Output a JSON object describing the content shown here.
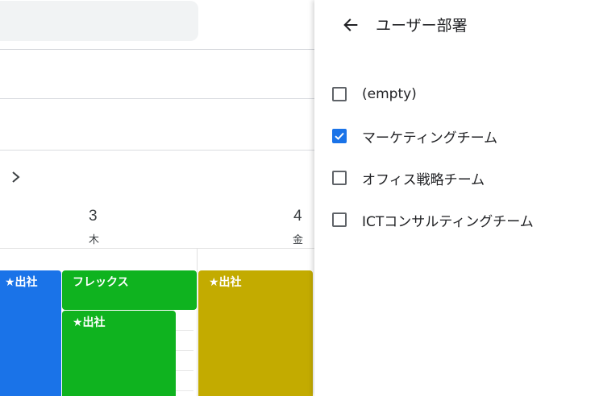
{
  "calendar": {
    "days": [
      {
        "number": "3",
        "weekday": "木"
      },
      {
        "number": "4",
        "weekday": "金"
      }
    ],
    "events": [
      {
        "label": "★出社",
        "color": "#1a73e8"
      },
      {
        "label": "フレックス",
        "color": "#0fb31f"
      },
      {
        "label": "★出社",
        "color": "#0fb31f"
      },
      {
        "label": "★出社",
        "color": "#c3ab00"
      }
    ]
  },
  "panel": {
    "title": "ユーザー部署",
    "back_icon": "arrow-left-icon",
    "options": [
      {
        "label": "(empty)",
        "checked": false
      },
      {
        "label": "マーケティングチーム",
        "checked": true
      },
      {
        "label": "オフィス戦略チーム",
        "checked": false
      },
      {
        "label": "ICTコンサルティングチーム",
        "checked": false
      }
    ]
  },
  "colors": {
    "accent": "#1a73e8",
    "event_green": "#0fb31f",
    "event_yellow": "#c3ab00"
  }
}
